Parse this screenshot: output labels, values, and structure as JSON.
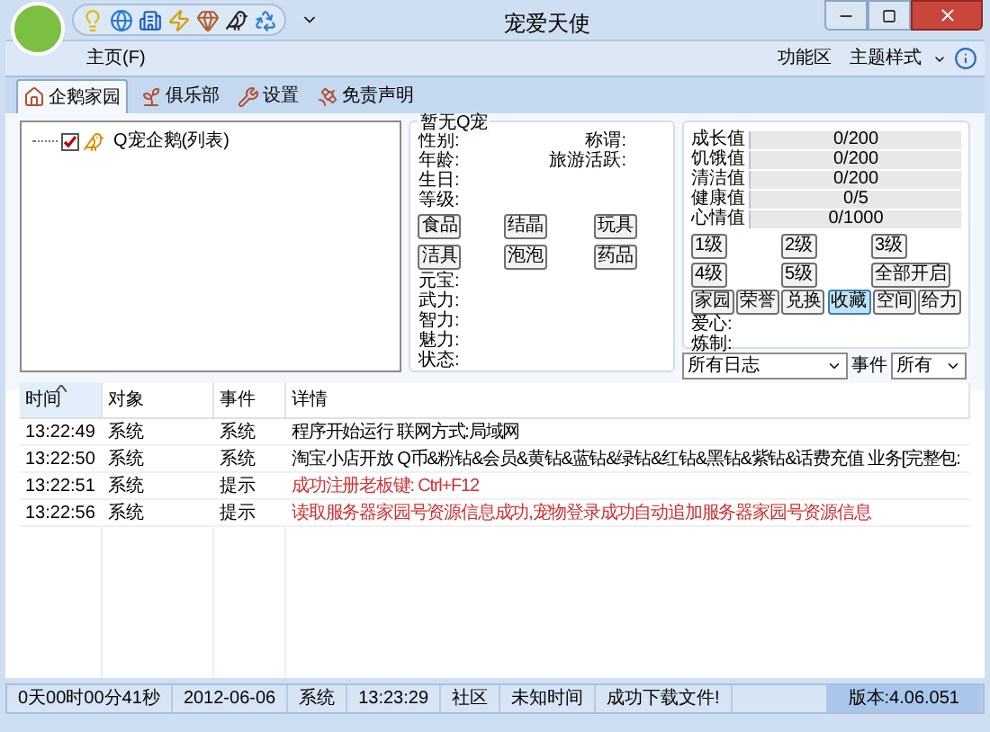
{
  "window": {
    "title": "宠爱天使"
  },
  "ribbon": {
    "menu": "主页(F)",
    "right_items": [
      "功能区",
      "主题样式"
    ]
  },
  "tabs": [
    {
      "label": "企鹅家园",
      "selected": true
    },
    {
      "label": "俱乐部",
      "selected": false
    },
    {
      "label": "设置",
      "selected": false
    },
    {
      "label": "免责声明",
      "selected": false
    }
  ],
  "tree": [
    {
      "label": "Q宠企鹅(列表)",
      "checked": true
    }
  ],
  "pet": {
    "title": "暂无Q宠",
    "fields_top": [
      {
        "left": "性别:",
        "right": "称谓:"
      },
      {
        "left": "年龄:",
        "right": "旅游活跃:"
      },
      {
        "left": "生日:"
      },
      {
        "left": "等级:"
      }
    ],
    "item_buttons": [
      "食品",
      "结晶",
      "玩具",
      "洁具",
      "泡泡",
      "药品"
    ],
    "fields_bottom": [
      "元宝:",
      "武力:",
      "智力:",
      "魅力:",
      "状态:"
    ]
  },
  "stats": [
    {
      "label": "成长值",
      "reading": "0/200",
      "level": 0
    },
    {
      "label": "饥饿值",
      "reading": "0/200",
      "level": 0
    },
    {
      "label": "清洁值",
      "reading": "0/200",
      "level": 0
    },
    {
      "label": "健康值",
      "reading": "0/5",
      "level": 0
    },
    {
      "label": "心情值",
      "reading": "0/1000",
      "level": 0
    }
  ],
  "level_buttons": [
    "1级",
    "2级",
    "3级",
    "4级",
    "5级",
    "全部开启"
  ],
  "action_buttons": [
    {
      "label": "家园",
      "selected": false
    },
    {
      "label": "荣誉",
      "selected": false
    },
    {
      "label": "兑换",
      "selected": false
    },
    {
      "label": "收藏",
      "selected": true
    },
    {
      "label": "空间",
      "selected": false
    },
    {
      "label": "给力",
      "selected": false
    }
  ],
  "extra_fields": [
    "爱心:",
    "炼制:"
  ],
  "log_filter": {
    "value": "所有日志"
  },
  "event_filter": {
    "label": "事件",
    "value": "所有"
  },
  "log": {
    "columns": [
      {
        "label": "时间",
        "sorted": true
      },
      {
        "label": "对象",
        "sorted": false
      },
      {
        "label": "事件",
        "sorted": false
      },
      {
        "label": "详情",
        "sorted": false
      }
    ],
    "rows": [
      {
        "cells": [
          "13:22:49",
          "系统",
          "系统",
          "程序开始运行 联网方式:局域网"
        ],
        "color": "#000000"
      },
      {
        "cells": [
          "13:22:50",
          "系统",
          "系统",
          "淘宝小店开放 Q币&粉钻&会员&黄钻&蓝钻&绿钻&红钻&黑钻&紫钻&话费充值 业务[完整包:"
        ],
        "color": "#000000"
      },
      {
        "cells": [
          "13:22:51",
          "系统",
          "提示",
          "成功注册老板键: Ctrl+F12"
        ],
        "color": "#d03030"
      },
      {
        "cells": [
          "13:22:56",
          "系统",
          "提示",
          "读取服务器家园号资源信息成功,宠物登录成功自动追加服务器家园号资源信息"
        ],
        "color": "#d03030"
      }
    ]
  },
  "status_bar": [
    "0天00时00分41秒",
    "2012-06-06",
    "系统",
    "13:23:29",
    "社区",
    "未知时间",
    "成功下载文件!",
    "版本:4.06.051"
  ]
}
